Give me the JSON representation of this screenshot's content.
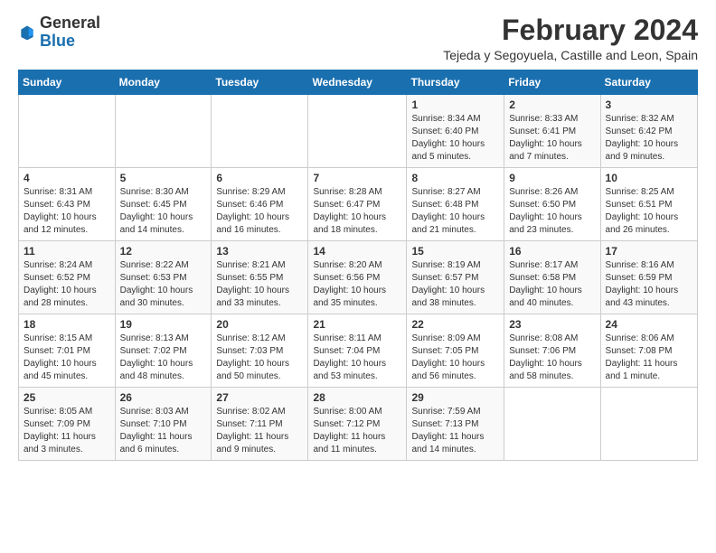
{
  "logo": {
    "general": "General",
    "blue": "Blue"
  },
  "header": {
    "month": "February 2024",
    "location": "Tejeda y Segoyuela, Castille and Leon, Spain"
  },
  "days_of_week": [
    "Sunday",
    "Monday",
    "Tuesday",
    "Wednesday",
    "Thursday",
    "Friday",
    "Saturday"
  ],
  "weeks": [
    [
      {
        "day": "",
        "info": ""
      },
      {
        "day": "",
        "info": ""
      },
      {
        "day": "",
        "info": ""
      },
      {
        "day": "",
        "info": ""
      },
      {
        "day": "1",
        "info": "Sunrise: 8:34 AM\nSunset: 6:40 PM\nDaylight: 10 hours and 5 minutes."
      },
      {
        "day": "2",
        "info": "Sunrise: 8:33 AM\nSunset: 6:41 PM\nDaylight: 10 hours and 7 minutes."
      },
      {
        "day": "3",
        "info": "Sunrise: 8:32 AM\nSunset: 6:42 PM\nDaylight: 10 hours and 9 minutes."
      }
    ],
    [
      {
        "day": "4",
        "info": "Sunrise: 8:31 AM\nSunset: 6:43 PM\nDaylight: 10 hours and 12 minutes."
      },
      {
        "day": "5",
        "info": "Sunrise: 8:30 AM\nSunset: 6:45 PM\nDaylight: 10 hours and 14 minutes."
      },
      {
        "day": "6",
        "info": "Sunrise: 8:29 AM\nSunset: 6:46 PM\nDaylight: 10 hours and 16 minutes."
      },
      {
        "day": "7",
        "info": "Sunrise: 8:28 AM\nSunset: 6:47 PM\nDaylight: 10 hours and 18 minutes."
      },
      {
        "day": "8",
        "info": "Sunrise: 8:27 AM\nSunset: 6:48 PM\nDaylight: 10 hours and 21 minutes."
      },
      {
        "day": "9",
        "info": "Sunrise: 8:26 AM\nSunset: 6:50 PM\nDaylight: 10 hours and 23 minutes."
      },
      {
        "day": "10",
        "info": "Sunrise: 8:25 AM\nSunset: 6:51 PM\nDaylight: 10 hours and 26 minutes."
      }
    ],
    [
      {
        "day": "11",
        "info": "Sunrise: 8:24 AM\nSunset: 6:52 PM\nDaylight: 10 hours and 28 minutes."
      },
      {
        "day": "12",
        "info": "Sunrise: 8:22 AM\nSunset: 6:53 PM\nDaylight: 10 hours and 30 minutes."
      },
      {
        "day": "13",
        "info": "Sunrise: 8:21 AM\nSunset: 6:55 PM\nDaylight: 10 hours and 33 minutes."
      },
      {
        "day": "14",
        "info": "Sunrise: 8:20 AM\nSunset: 6:56 PM\nDaylight: 10 hours and 35 minutes."
      },
      {
        "day": "15",
        "info": "Sunrise: 8:19 AM\nSunset: 6:57 PM\nDaylight: 10 hours and 38 minutes."
      },
      {
        "day": "16",
        "info": "Sunrise: 8:17 AM\nSunset: 6:58 PM\nDaylight: 10 hours and 40 minutes."
      },
      {
        "day": "17",
        "info": "Sunrise: 8:16 AM\nSunset: 6:59 PM\nDaylight: 10 hours and 43 minutes."
      }
    ],
    [
      {
        "day": "18",
        "info": "Sunrise: 8:15 AM\nSunset: 7:01 PM\nDaylight: 10 hours and 45 minutes."
      },
      {
        "day": "19",
        "info": "Sunrise: 8:13 AM\nSunset: 7:02 PM\nDaylight: 10 hours and 48 minutes."
      },
      {
        "day": "20",
        "info": "Sunrise: 8:12 AM\nSunset: 7:03 PM\nDaylight: 10 hours and 50 minutes."
      },
      {
        "day": "21",
        "info": "Sunrise: 8:11 AM\nSunset: 7:04 PM\nDaylight: 10 hours and 53 minutes."
      },
      {
        "day": "22",
        "info": "Sunrise: 8:09 AM\nSunset: 7:05 PM\nDaylight: 10 hours and 56 minutes."
      },
      {
        "day": "23",
        "info": "Sunrise: 8:08 AM\nSunset: 7:06 PM\nDaylight: 10 hours and 58 minutes."
      },
      {
        "day": "24",
        "info": "Sunrise: 8:06 AM\nSunset: 7:08 PM\nDaylight: 11 hours and 1 minute."
      }
    ],
    [
      {
        "day": "25",
        "info": "Sunrise: 8:05 AM\nSunset: 7:09 PM\nDaylight: 11 hours and 3 minutes."
      },
      {
        "day": "26",
        "info": "Sunrise: 8:03 AM\nSunset: 7:10 PM\nDaylight: 11 hours and 6 minutes."
      },
      {
        "day": "27",
        "info": "Sunrise: 8:02 AM\nSunset: 7:11 PM\nDaylight: 11 hours and 9 minutes."
      },
      {
        "day": "28",
        "info": "Sunrise: 8:00 AM\nSunset: 7:12 PM\nDaylight: 11 hours and 11 minutes."
      },
      {
        "day": "29",
        "info": "Sunrise: 7:59 AM\nSunset: 7:13 PM\nDaylight: 11 hours and 14 minutes."
      },
      {
        "day": "",
        "info": ""
      },
      {
        "day": "",
        "info": ""
      }
    ]
  ]
}
